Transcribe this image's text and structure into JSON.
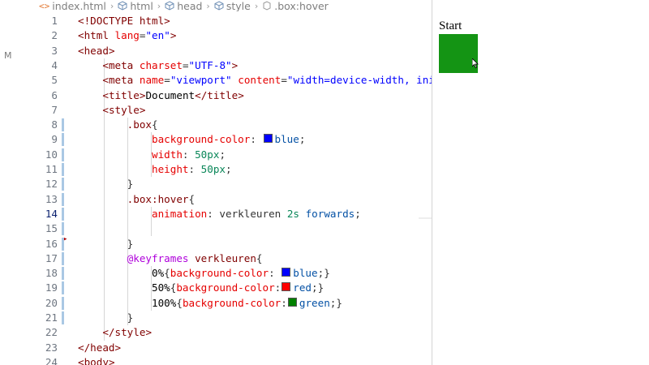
{
  "breadcrumb": {
    "items": [
      "index.html",
      "html",
      "head",
      "style",
      ".box:hover"
    ],
    "file_icon": "html-file-icon",
    "element_icon": "cube-icon"
  },
  "scm": {
    "badge": "M"
  },
  "editor": {
    "active_line": 14,
    "swatches": {
      "blue": "#0000ff",
      "red": "#ff0000",
      "green": "#008000"
    },
    "lines": [
      {
        "n": "1",
        "tokens": [
          {
            "c": "t-punct",
            "t": "<!DOCTYPE "
          },
          {
            "c": "t-tag",
            "t": "html"
          },
          {
            "c": "t-punct",
            "t": ">"
          }
        ]
      },
      {
        "n": "2",
        "tokens": [
          {
            "c": "t-punct",
            "t": "<"
          },
          {
            "c": "t-tag",
            "t": "html"
          },
          {
            "c": "t-plain",
            "t": " "
          },
          {
            "c": "t-attr",
            "t": "lang"
          },
          {
            "c": "t-plain",
            "t": "="
          },
          {
            "c": "t-str",
            "t": "\"en\""
          },
          {
            "c": "t-punct",
            "t": ">"
          }
        ]
      },
      {
        "n": "3",
        "tokens": [
          {
            "c": "t-punct",
            "t": "<"
          },
          {
            "c": "t-tag",
            "t": "head"
          },
          {
            "c": "t-punct",
            "t": ">"
          }
        ]
      },
      {
        "n": "4",
        "tokens": [
          {
            "c": "t-plain",
            "t": "    "
          },
          {
            "c": "t-punct",
            "t": "<"
          },
          {
            "c": "t-tag",
            "t": "meta"
          },
          {
            "c": "t-plain",
            "t": " "
          },
          {
            "c": "t-attr",
            "t": "charset"
          },
          {
            "c": "t-plain",
            "t": "="
          },
          {
            "c": "t-str",
            "t": "\"UTF-8\""
          },
          {
            "c": "t-punct",
            "t": ">"
          }
        ]
      },
      {
        "n": "5",
        "tokens": [
          {
            "c": "t-plain",
            "t": "    "
          },
          {
            "c": "t-punct",
            "t": "<"
          },
          {
            "c": "t-tag",
            "t": "meta"
          },
          {
            "c": "t-plain",
            "t": " "
          },
          {
            "c": "t-attr",
            "t": "name"
          },
          {
            "c": "t-plain",
            "t": "="
          },
          {
            "c": "t-str",
            "t": "\"viewport\""
          },
          {
            "c": "t-plain",
            "t": " "
          },
          {
            "c": "t-attr",
            "t": "content"
          },
          {
            "c": "t-plain",
            "t": "="
          },
          {
            "c": "t-str",
            "t": "\"width=device-width, init"
          }
        ]
      },
      {
        "n": "6",
        "tokens": [
          {
            "c": "t-plain",
            "t": "    "
          },
          {
            "c": "t-punct",
            "t": "<"
          },
          {
            "c": "t-tag",
            "t": "title"
          },
          {
            "c": "t-punct",
            "t": ">"
          },
          {
            "c": "t-text",
            "t": "Document"
          },
          {
            "c": "t-punct",
            "t": "</"
          },
          {
            "c": "t-tag",
            "t": "title"
          },
          {
            "c": "t-punct",
            "t": ">"
          }
        ]
      },
      {
        "n": "7",
        "tokens": [
          {
            "c": "t-plain",
            "t": "    "
          },
          {
            "c": "t-punct",
            "t": "<"
          },
          {
            "c": "t-tag",
            "t": "style"
          },
          {
            "c": "t-punct",
            "t": ">"
          }
        ]
      },
      {
        "n": "8",
        "tokens": [
          {
            "c": "t-plain",
            "t": "        "
          },
          {
            "c": "t-sel",
            "t": ".box"
          },
          {
            "c": "t-plain",
            "t": "{"
          }
        ]
      },
      {
        "n": "9",
        "tokens": [
          {
            "c": "t-plain",
            "t": "            "
          },
          {
            "c": "t-prop",
            "t": "background-color"
          },
          {
            "c": "t-plain",
            "t": ": "
          },
          {
            "swatch": "blue"
          },
          {
            "c": "t-val",
            "t": "blue"
          },
          {
            "c": "t-plain",
            "t": ";"
          }
        ]
      },
      {
        "n": "10",
        "tokens": [
          {
            "c": "t-plain",
            "t": "            "
          },
          {
            "c": "t-prop",
            "t": "width"
          },
          {
            "c": "t-plain",
            "t": ": "
          },
          {
            "c": "t-num",
            "t": "50px"
          },
          {
            "c": "t-plain",
            "t": ";"
          }
        ]
      },
      {
        "n": "11",
        "tokens": [
          {
            "c": "t-plain",
            "t": "            "
          },
          {
            "c": "t-prop",
            "t": "height"
          },
          {
            "c": "t-plain",
            "t": ": "
          },
          {
            "c": "t-num",
            "t": "50px"
          },
          {
            "c": "t-plain",
            "t": ";"
          }
        ]
      },
      {
        "n": "12",
        "tokens": [
          {
            "c": "t-plain",
            "t": "        "
          },
          {
            "c": "t-plain",
            "t": "}"
          }
        ]
      },
      {
        "n": "13",
        "tokens": [
          {
            "c": "t-plain",
            "t": "        "
          },
          {
            "c": "t-sel",
            "t": ".box:hover"
          },
          {
            "c": "t-plain",
            "t": "{"
          }
        ]
      },
      {
        "n": "14",
        "tokens": [
          {
            "c": "t-plain",
            "t": "            "
          },
          {
            "c": "t-prop",
            "t": "animation"
          },
          {
            "c": "t-plain",
            "t": ": verkleuren "
          },
          {
            "c": "t-num",
            "t": "2s"
          },
          {
            "c": "t-plain",
            "t": " "
          },
          {
            "c": "t-val",
            "t": "forwards"
          },
          {
            "c": "t-plain",
            "t": ";"
          }
        ]
      },
      {
        "n": "15",
        "tokens": []
      },
      {
        "n": "16",
        "tokens": [
          {
            "c": "t-plain",
            "t": "        "
          },
          {
            "c": "t-plain",
            "t": "}"
          }
        ]
      },
      {
        "n": "17",
        "tokens": [
          {
            "c": "t-plain",
            "t": "        "
          },
          {
            "c": "t-at",
            "t": "@keyframes"
          },
          {
            "c": "t-plain",
            "t": " "
          },
          {
            "c": "t-kf",
            "t": "verkleuren"
          },
          {
            "c": "t-plain",
            "t": "{"
          }
        ]
      },
      {
        "n": "18",
        "tokens": [
          {
            "c": "t-plain",
            "t": "            "
          },
          {
            "c": "t-pct",
            "t": "0%"
          },
          {
            "c": "t-plain",
            "t": "{"
          },
          {
            "c": "t-prop",
            "t": "background-color"
          },
          {
            "c": "t-plain",
            "t": ": "
          },
          {
            "swatch": "blue"
          },
          {
            "c": "t-val",
            "t": "blue"
          },
          {
            "c": "t-plain",
            "t": ";}"
          }
        ]
      },
      {
        "n": "19",
        "tokens": [
          {
            "c": "t-plain",
            "t": "            "
          },
          {
            "c": "t-pct",
            "t": "50%"
          },
          {
            "c": "t-plain",
            "t": "{"
          },
          {
            "c": "t-prop",
            "t": "background-color"
          },
          {
            "c": "t-plain",
            "t": ":"
          },
          {
            "swatch": "red"
          },
          {
            "c": "t-val",
            "t": "red"
          },
          {
            "c": "t-plain",
            "t": ";}"
          }
        ]
      },
      {
        "n": "20",
        "tokens": [
          {
            "c": "t-plain",
            "t": "            "
          },
          {
            "c": "t-pct",
            "t": "100%"
          },
          {
            "c": "t-plain",
            "t": "{"
          },
          {
            "c": "t-prop",
            "t": "background-color"
          },
          {
            "c": "t-plain",
            "t": ":"
          },
          {
            "swatch": "green"
          },
          {
            "c": "t-val",
            "t": "green"
          },
          {
            "c": "t-plain",
            "t": ";}"
          }
        ]
      },
      {
        "n": "21",
        "tokens": [
          {
            "c": "t-plain",
            "t": "        "
          },
          {
            "c": "t-plain",
            "t": "}"
          }
        ]
      },
      {
        "n": "22",
        "tokens": [
          {
            "c": "t-plain",
            "t": "    "
          },
          {
            "c": "t-punct",
            "t": "</"
          },
          {
            "c": "t-tag",
            "t": "style"
          },
          {
            "c": "t-punct",
            "t": ">"
          }
        ]
      },
      {
        "n": "23",
        "tokens": [
          {
            "c": "t-punct",
            "t": "</"
          },
          {
            "c": "t-tag",
            "t": "head"
          },
          {
            "c": "t-punct",
            "t": ">"
          }
        ]
      },
      {
        "n": "24",
        "tokens": [
          {
            "c": "t-punct",
            "t": "<"
          },
          {
            "c": "t-tag",
            "t": "body"
          },
          {
            "c": "t-punct",
            "t": ">"
          }
        ]
      }
    ]
  },
  "preview": {
    "title": "Start",
    "box_color": "#149414"
  }
}
